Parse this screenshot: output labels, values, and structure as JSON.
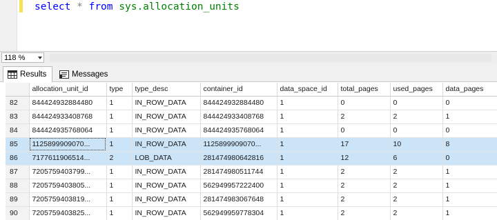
{
  "editor": {
    "tokens": {
      "select": "select",
      "star": "*",
      "from": "from",
      "object": "sys.allocation_units"
    }
  },
  "zoom": {
    "value": "118 %"
  },
  "tabs": [
    {
      "label": "Results",
      "icon": "grid-icon"
    },
    {
      "label": "Messages",
      "icon": "messages-icon"
    }
  ],
  "grid": {
    "columns": [
      "allocation_unit_id",
      "type",
      "type_desc",
      "container_id",
      "data_space_id",
      "total_pages",
      "used_pages",
      "data_pages"
    ],
    "rows": [
      {
        "num": "82",
        "cells": [
          "844424932884480",
          "1",
          "IN_ROW_DATA",
          "844424932884480",
          "1",
          "0",
          "0",
          "0"
        ],
        "selected": false
      },
      {
        "num": "83",
        "cells": [
          "844424933408768",
          "1",
          "IN_ROW_DATA",
          "844424933408768",
          "1",
          "2",
          "2",
          "1"
        ],
        "selected": false
      },
      {
        "num": "84",
        "cells": [
          "844424935768064",
          "1",
          "IN_ROW_DATA",
          "844424935768064",
          "1",
          "0",
          "0",
          "0"
        ],
        "selected": false
      },
      {
        "num": "85",
        "cells": [
          "1125899909070...",
          "1",
          "IN_ROW_DATA",
          "1125899909070...",
          "1",
          "17",
          "10",
          "8"
        ],
        "selected": true
      },
      {
        "num": "86",
        "cells": [
          "7177611906514...",
          "2",
          "LOB_DATA",
          "281474980642816",
          "1",
          "12",
          "6",
          "0"
        ],
        "selected": true
      },
      {
        "num": "87",
        "cells": [
          "7205759403799...",
          "1",
          "IN_ROW_DATA",
          "281474980511744",
          "1",
          "2",
          "2",
          "1"
        ],
        "selected": false
      },
      {
        "num": "88",
        "cells": [
          "7205759403805...",
          "1",
          "IN_ROW_DATA",
          "562949957222400",
          "1",
          "2",
          "2",
          "1"
        ],
        "selected": false
      },
      {
        "num": "89",
        "cells": [
          "7205759403819...",
          "1",
          "IN_ROW_DATA",
          "281474983067648",
          "1",
          "2",
          "2",
          "1"
        ],
        "selected": false
      },
      {
        "num": "90",
        "cells": [
          "7205759403825...",
          "1",
          "IN_ROW_DATA",
          "562949959778304",
          "1",
          "2",
          "2",
          "1"
        ],
        "selected": false
      }
    ]
  }
}
